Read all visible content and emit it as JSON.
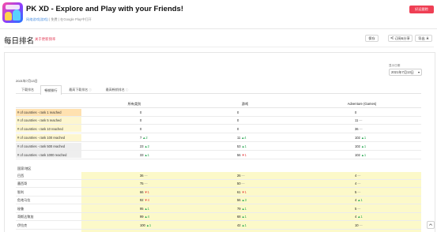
{
  "header": {
    "app_title": "PK XD - Explore and Play with your Friends!",
    "app_developer": "网络游戏(游戏)",
    "app_meta_rest": " | 免费 | 在Google Play中打开 ",
    "track_button": "好运跟踪"
  },
  "page": {
    "title": "每日排名",
    "subtitle": "关于更新频率",
    "actions": {
      "save": "保存",
      "subscribe": "订阅&分享",
      "export": "导出"
    }
  },
  "filter": {
    "compare_label": "显示日期",
    "date_selected": "2021年7月13日",
    "date_text": "2021年7月13日"
  },
  "tabs": [
    {
      "label": "下载排名",
      "info": ""
    },
    {
      "label": "畅销排行",
      "info": ""
    },
    {
      "label": "最高下载排名",
      "info": "ⓘ"
    },
    {
      "label": "最高畅销排名",
      "info": "ⓘ"
    }
  ],
  "table": {
    "columns": [
      "所有类别",
      "游戏",
      "Adventure (Games)"
    ],
    "summary_rows": [
      {
        "label": "# of countries - rank 1 reached",
        "values": [
          "0",
          "0",
          "0"
        ],
        "deltas": [
          "",
          "",
          ""
        ]
      },
      {
        "label": "# of countries - rank 5 reached",
        "values": [
          "0",
          "0",
          "11"
        ],
        "deltas": [
          "",
          "",
          "—"
        ]
      },
      {
        "label": "# of countries - rank 10 reached",
        "values": [
          "0",
          "0",
          "36"
        ],
        "deltas": [
          "",
          "",
          "—"
        ]
      },
      {
        "label": "# of countries - rank 100 reached",
        "values": [
          "7",
          "11",
          "102"
        ],
        "deltas": [
          "▲2",
          "▲4",
          "▲1"
        ]
      },
      {
        "label": "# of countries - rank 500 reached",
        "values": [
          "23",
          "53",
          "102"
        ],
        "deltas": [
          "▲2",
          "▲1",
          "▲1"
        ]
      },
      {
        "label": "# of countries - rank 1000 reached",
        "values": [
          "33",
          "56",
          "102"
        ],
        "deltas": [
          "▲1",
          "▼1",
          "▲1"
        ]
      }
    ],
    "section_label": "国家/地区",
    "country_rows": [
      {
        "label": "巴西",
        "values": [
          "36",
          "26",
          "4"
        ],
        "deltas": [
          "—",
          "—",
          "—"
        ]
      },
      {
        "label": "墨西哥",
        "values": [
          "75",
          "50",
          "4"
        ],
        "deltas": [
          "—",
          "—",
          "—"
        ]
      },
      {
        "label": "智利",
        "values": [
          "66",
          "61",
          "5"
        ],
        "deltas": [
          "▼1",
          "▼1",
          "—"
        ]
      },
      {
        "label": "危地马拉",
        "values": [
          "92",
          "56",
          "4"
        ],
        "deltas": [
          "▼4",
          "▲3",
          "▲1"
        ]
      },
      {
        "label": "秘鲁",
        "values": [
          "95",
          "79",
          "5"
        ],
        "deltas": [
          "▲1",
          "▲1",
          "—"
        ]
      },
      {
        "label": "哥斯达黎加",
        "values": [
          "99",
          "68",
          "4"
        ],
        "deltas": [
          "▲4",
          "▲1",
          "▲1"
        ]
      },
      {
        "label": "伊拉克",
        "values": [
          "100",
          "42",
          "10"
        ],
        "deltas": [
          "▲1",
          "▲1",
          "—"
        ]
      }
    ]
  },
  "colors": {
    "accent": "#ef3f54",
    "rank1_bg": "#ffe1b0",
    "summary_bg": "#fdf6cf",
    "summary_dark_bg": "#eeeeee",
    "country_bg": "#fcf9c9",
    "up": "#1fa44a",
    "down": "#e53b3b"
  },
  "icons": {
    "save": "save-icon",
    "subscribe": "share-icon",
    "export": "download-icon",
    "scroll": "scroll-top-icon"
  }
}
